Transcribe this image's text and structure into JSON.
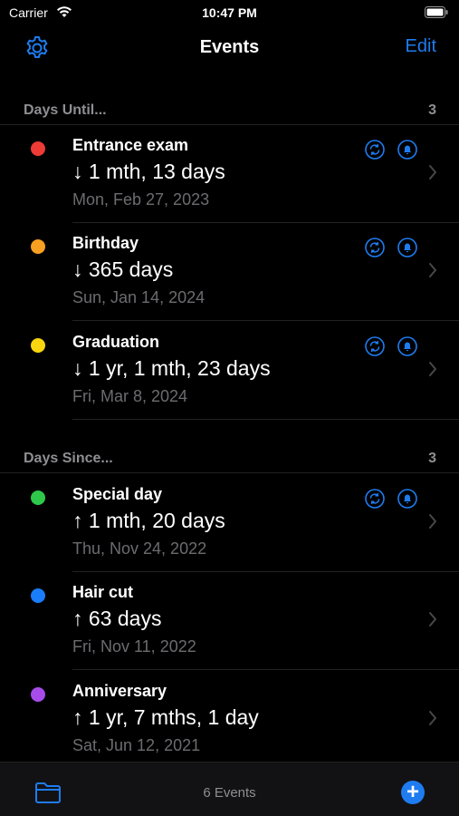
{
  "status_bar": {
    "carrier": "Carrier",
    "time": "10:47 PM"
  },
  "nav": {
    "title": "Events",
    "edit_label": "Edit",
    "left_icon": "gear-icon"
  },
  "colors": {
    "accent": "#1e7cf0",
    "red": "#ee3b36",
    "orange": "#f7a021",
    "yellow": "#f8d50f",
    "green": "#2ec84b",
    "blue": "#1a7dfb",
    "purple": "#a74cea"
  },
  "sections": [
    {
      "title": "Days Until...",
      "count": "3",
      "items": [
        {
          "name": "Entrance exam",
          "delta": "↓ 1 mth, 13 days",
          "date": "Mon, Feb 27, 2023",
          "color": "red",
          "repeat": true,
          "reminder": true
        },
        {
          "name": "Birthday",
          "delta": "↓ 365 days",
          "date": "Sun, Jan 14, 2024",
          "color": "orange",
          "repeat": true,
          "reminder": true
        },
        {
          "name": "Graduation",
          "delta": "↓ 1 yr, 1 mth, 23 days",
          "date": "Fri, Mar 8, 2024",
          "color": "yellow",
          "repeat": true,
          "reminder": true
        }
      ]
    },
    {
      "title": "Days Since...",
      "count": "3",
      "items": [
        {
          "name": "Special day",
          "delta": "↑ 1 mth, 20 days",
          "date": "Thu, Nov 24, 2022",
          "color": "green",
          "repeat": true,
          "reminder": true
        },
        {
          "name": "Hair cut",
          "delta": "↑ 63 days",
          "date": "Fri, Nov 11, 2022",
          "color": "blue",
          "repeat": false,
          "reminder": false
        },
        {
          "name": "Anniversary",
          "delta": "↑ 1 yr, 7 mths, 1 day",
          "date": "Sat, Jun 12, 2021",
          "color": "purple",
          "repeat": false,
          "reminder": false
        }
      ]
    }
  ],
  "tab_bar": {
    "count_label": "6 Events",
    "add_icon": "plus-icon",
    "folder_icon": "folder-icon"
  }
}
